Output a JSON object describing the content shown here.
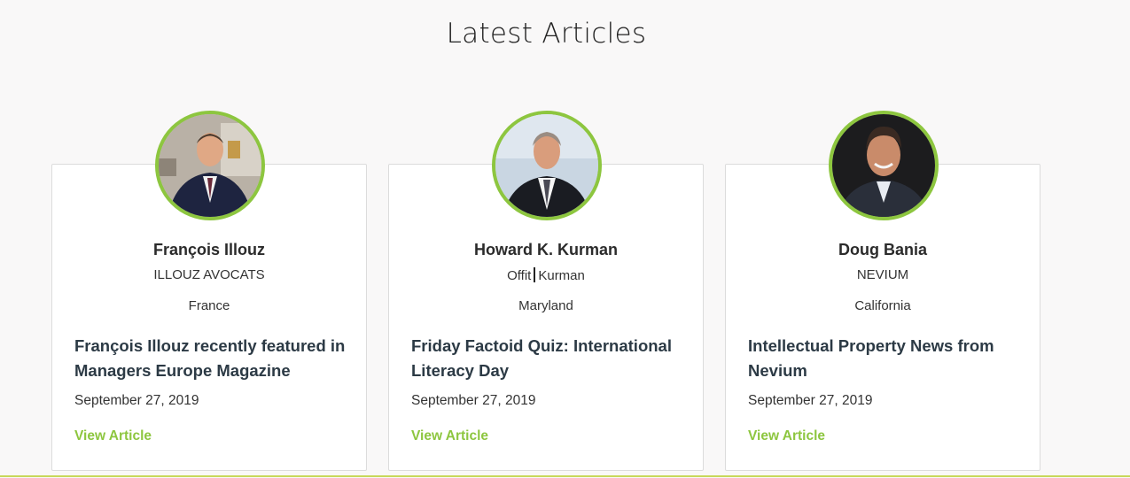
{
  "section": {
    "title": "Latest Articles"
  },
  "colors": {
    "accent": "#8dc63f",
    "headline": "#2c3a45",
    "background": "#f9f8f8"
  },
  "articles": [
    {
      "name": "François Illouz",
      "firm": "ILLOUZ AVOCATS",
      "location": "France",
      "headline": "François Illouz recently featured in Managers Europe Magazine",
      "date": "September 27, 2019",
      "link_label": "View Article"
    },
    {
      "name": "Howard K. Kurman",
      "firm_part1": "Offit",
      "firm_part2": "Kurman",
      "location": "Maryland",
      "headline": "Friday Factoid Quiz: International Literacy Day",
      "date": "September 27, 2019",
      "link_label": "View Article"
    },
    {
      "name": "Doug Bania",
      "firm": "NEVIUM",
      "location": "California",
      "headline": "Intellectual Property News from Nevium",
      "date": "September 27, 2019",
      "link_label": "View Article"
    }
  ]
}
